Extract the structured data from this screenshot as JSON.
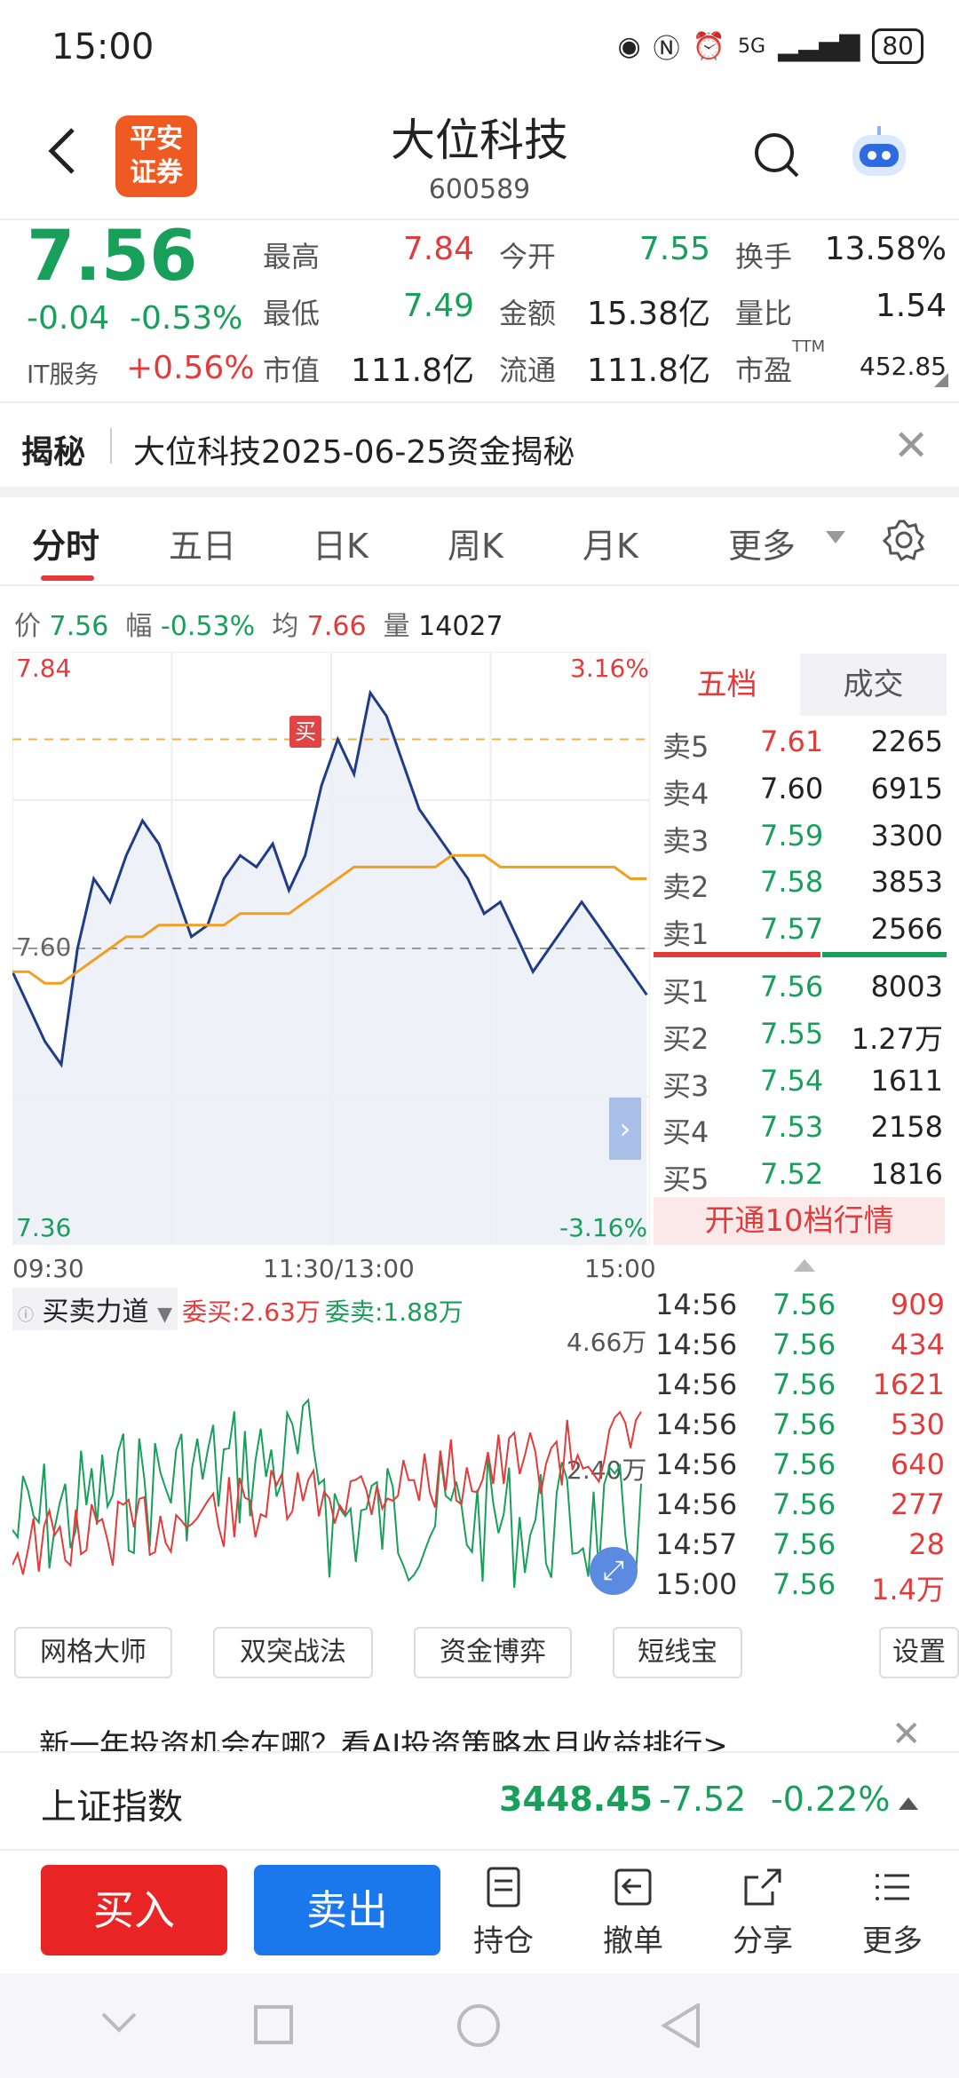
{
  "status": {
    "time": "15:00",
    "network": "5G",
    "battery": "80"
  },
  "header": {
    "logo_line1": "平安",
    "logo_line2": "证券",
    "title": "大位科技",
    "code": "600589"
  },
  "quote": {
    "price": "7.56",
    "change": "-0.04",
    "change_pct": "-0.53%",
    "industry": "IT服务",
    "industry_pct": "+0.56%",
    "stats": [
      {
        "label": "最高",
        "value": "7.84",
        "color": "#e33b3b"
      },
      {
        "label": "今开",
        "value": "7.55",
        "color": "#18a05a"
      },
      {
        "label": "换手",
        "value": "13.58%",
        "color": "#222222"
      },
      {
        "label": "最低",
        "value": "7.49",
        "color": "#18a05a"
      },
      {
        "label": "金额",
        "value": "15.38亿",
        "color": "#222222"
      },
      {
        "label": "量比",
        "value": "1.54",
        "color": "#222222"
      },
      {
        "label": "市值",
        "value": "111.8亿",
        "color": "#222222"
      },
      {
        "label": "流通",
        "value": "111.8亿",
        "color": "#222222"
      },
      {
        "label": "市盈",
        "value": "452.85",
        "color": "#222222"
      }
    ],
    "pe_sup": "TTM"
  },
  "reveal": {
    "tag": "揭秘",
    "text": "大位科技2025-06-25资金揭秘"
  },
  "tabs": [
    "分时",
    "五日",
    "日K",
    "周K",
    "月K",
    "更多"
  ],
  "info": {
    "price_label": "价",
    "price": "7.56",
    "amp_label": "幅",
    "amp": "-0.53%",
    "avg_label": "均",
    "avg": "7.66",
    "vol_label": "量",
    "vol": "14027"
  },
  "chart_data": {
    "type": "line",
    "y_labels": {
      "top": "7.84",
      "mid": "7.60",
      "bottom": "7.36",
      "top_pct": "3.16%",
      "bottom_pct": "-3.16%"
    },
    "x_labels": [
      "09:30",
      "11:30/13:00",
      "15:00"
    ],
    "ylim": [
      7.36,
      7.84
    ],
    "prev_close": 7.6,
    "marker": "买",
    "series": [
      {
        "values": [
          7.58,
          7.55,
          7.52,
          7.5,
          7.6,
          7.66,
          7.64,
          7.68,
          7.71,
          7.69,
          7.65,
          7.61,
          7.62,
          7.66,
          7.68,
          7.67,
          7.69,
          7.65,
          7.68,
          7.74,
          7.78,
          7.75,
          7.82,
          7.8,
          7.76,
          7.72,
          7.7,
          7.68,
          7.66,
          7.63,
          7.64,
          7.61,
          7.58,
          7.6,
          7.62,
          7.64,
          7.62,
          7.6,
          7.58,
          7.56
        ]
      },
      {
        "values": [
          7.58,
          7.58,
          7.57,
          7.57,
          7.58,
          7.59,
          7.6,
          7.61,
          7.61,
          7.62,
          7.62,
          7.62,
          7.62,
          7.62,
          7.63,
          7.63,
          7.63,
          7.63,
          7.64,
          7.65,
          7.66,
          7.67,
          7.67,
          7.67,
          7.67,
          7.67,
          7.67,
          7.68,
          7.68,
          7.68,
          7.67,
          7.67,
          7.67,
          7.67,
          7.67,
          7.67,
          7.67,
          7.67,
          7.66,
          7.66
        ]
      }
    ]
  },
  "orderbook": {
    "tabs": [
      "五档",
      "成交"
    ],
    "asks": [
      {
        "label": "卖5",
        "price": "7.61",
        "vol": "2265",
        "pc": "#e33b3b"
      },
      {
        "label": "卖4",
        "price": "7.60",
        "vol": "6915",
        "pc": "#222222"
      },
      {
        "label": "卖3",
        "price": "7.59",
        "vol": "3300",
        "pc": "#18a05a"
      },
      {
        "label": "卖2",
        "price": "7.58",
        "vol": "3853",
        "pc": "#18a05a"
      },
      {
        "label": "卖1",
        "price": "7.57",
        "vol": "2566",
        "pc": "#18a05a"
      }
    ],
    "bids": [
      {
        "label": "买1",
        "price": "7.56",
        "vol": "8003",
        "pc": "#18a05a"
      },
      {
        "label": "买2",
        "price": "7.55",
        "vol": "1.27万",
        "pc": "#18a05a"
      },
      {
        "label": "买3",
        "price": "7.54",
        "vol": "1611",
        "pc": "#18a05a"
      },
      {
        "label": "买4",
        "price": "7.53",
        "vol": "2158",
        "pc": "#18a05a"
      },
      {
        "label": "买5",
        "price": "7.52",
        "vol": "1816",
        "pc": "#18a05a"
      }
    ],
    "open10": "开通10档行情"
  },
  "ticks": [
    {
      "t": "14:56",
      "p": "7.56",
      "v": "909"
    },
    {
      "t": "14:56",
      "p": "7.56",
      "v": "434"
    },
    {
      "t": "14:56",
      "p": "7.56",
      "v": "1621"
    },
    {
      "t": "14:56",
      "p": "7.56",
      "v": "530"
    },
    {
      "t": "14:56",
      "p": "7.56",
      "v": "640"
    },
    {
      "t": "14:56",
      "p": "7.56",
      "v": "277"
    },
    {
      "t": "14:57",
      "p": "7.56",
      "v": "28"
    },
    {
      "t": "15:00",
      "p": "7.56",
      "v": "1.4万"
    }
  ],
  "subchart": {
    "indicator": "买卖力道",
    "buy_label": "委买:2.63万",
    "sell_label": "委卖:1.88万",
    "top": "4.66万",
    "mid": "2.40万"
  },
  "tools": [
    "网格大师",
    "双突战法",
    "资金博弈",
    "短线宝",
    "设置"
  ],
  "promo": "新一年投资机会在哪？看AI投资策略本月收益排行>",
  "index": {
    "name": "上证指数",
    "value": "3448.45",
    "change": "-7.52",
    "pct": "-0.22%"
  },
  "bottom": {
    "buy": "买入",
    "sell": "卖出",
    "items": [
      "持仓",
      "撤单",
      "分享",
      "更多"
    ]
  }
}
